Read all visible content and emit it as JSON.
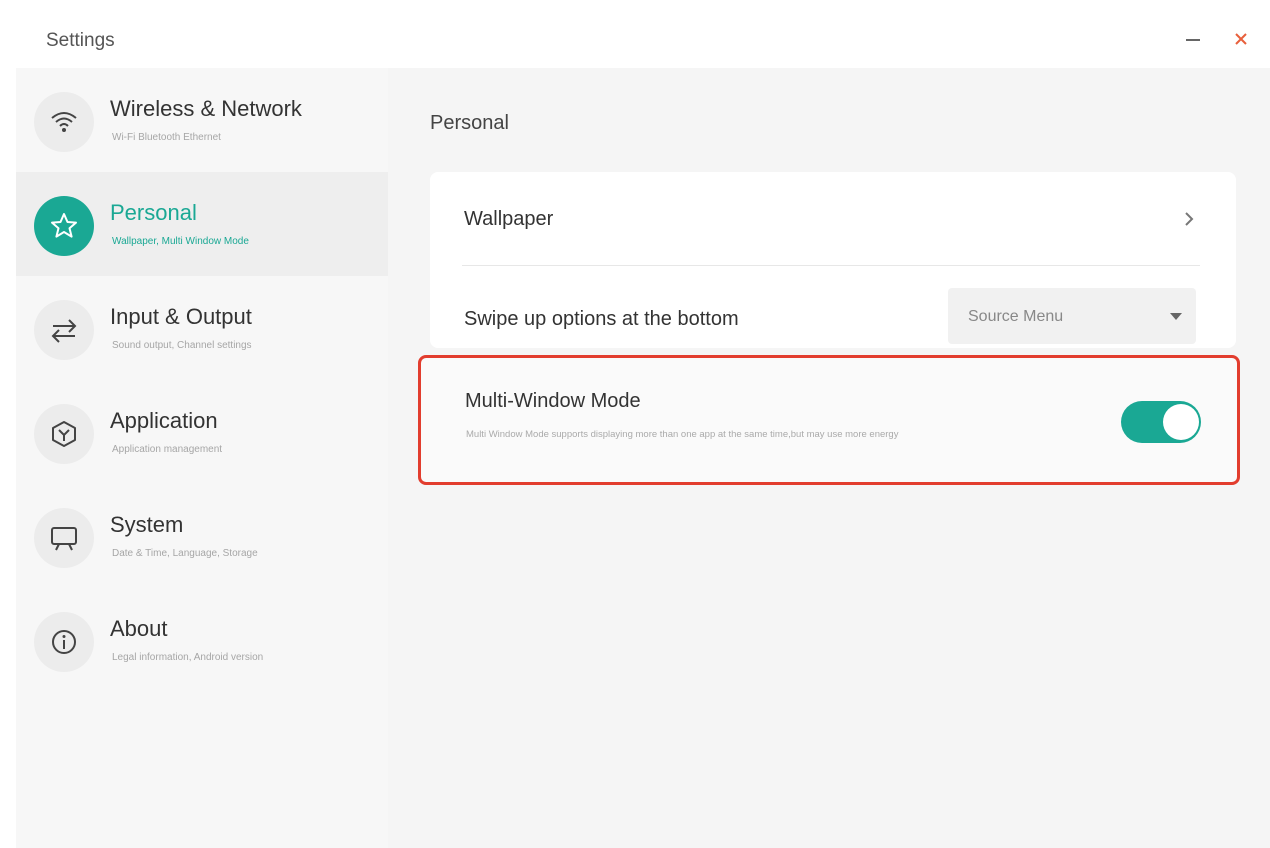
{
  "window": {
    "title": "Settings"
  },
  "sidebar": {
    "items": [
      {
        "label": "Wireless & Network",
        "sub": "Wi-Fi Bluetooth Ethernet",
        "icon": "wifi-icon",
        "active": false
      },
      {
        "label": "Personal",
        "sub": "Wallpaper, Multi Window Mode",
        "icon": "star-icon",
        "active": true
      },
      {
        "label": "Input & Output",
        "sub": "Sound output, Channel settings",
        "icon": "swap-arrows-icon",
        "active": false
      },
      {
        "label": "Application",
        "sub": "Application management",
        "icon": "app-hexagon-icon",
        "active": false
      },
      {
        "label": "System",
        "sub": "Date & Time, Language, Storage",
        "icon": "monitor-icon",
        "active": false
      },
      {
        "label": "About",
        "sub": "Legal information, Android version",
        "icon": "info-icon",
        "active": false
      }
    ]
  },
  "main": {
    "title": "Personal",
    "wallpaper": {
      "label": "Wallpaper"
    },
    "swipe": {
      "label": "Swipe up options at the bottom",
      "selected": "Source Menu"
    },
    "multi_window": {
      "label": "Multi-Window Mode",
      "description": "Multi Window Mode supports displaying more than one app at the same time,but may use more energy",
      "enabled": true
    }
  },
  "colors": {
    "accent": "#1aa894",
    "highlight_border": "#e23d2e"
  }
}
